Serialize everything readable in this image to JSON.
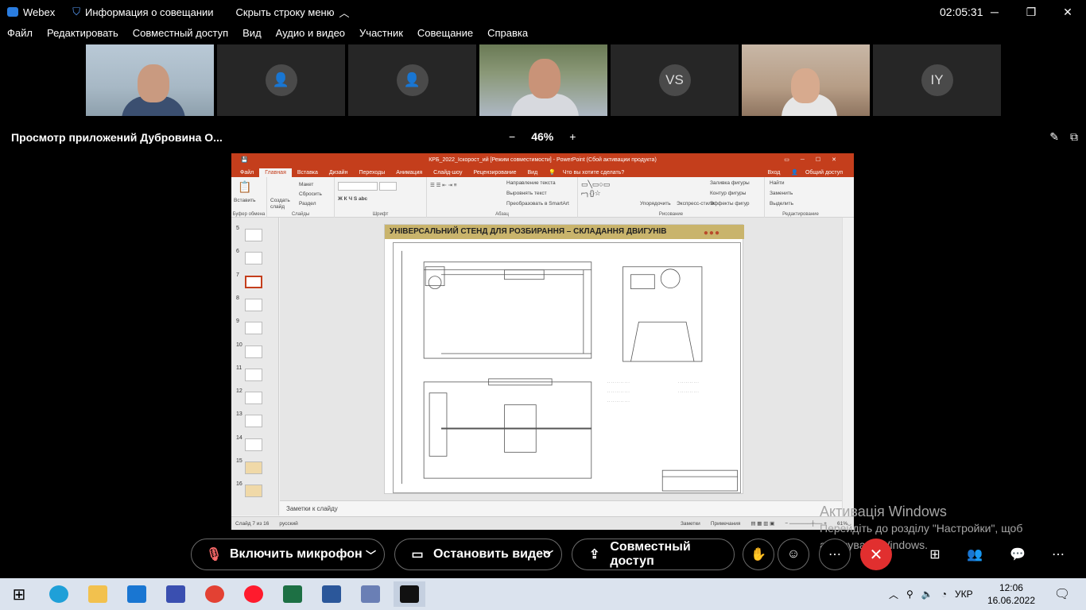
{
  "app": {
    "name": "Webex",
    "meeting_info": "Информация о совещании",
    "hide_menu": "Скрыть строку меню",
    "clock": "02:05:31"
  },
  "menu": [
    "Файл",
    "Редактировать",
    "Совместный доступ",
    "Вид",
    "Аудио и видео",
    "Участник",
    "Совещание",
    "Справка"
  ],
  "participants": [
    {
      "type": "video",
      "initials": ""
    },
    {
      "type": "avatar",
      "initials": ""
    },
    {
      "type": "avatar",
      "initials": ""
    },
    {
      "type": "video",
      "initials": ""
    },
    {
      "type": "avatar",
      "initials": "VS"
    },
    {
      "type": "video",
      "initials": ""
    },
    {
      "type": "avatar",
      "initials": "IY"
    }
  ],
  "share": {
    "title": "Просмотр приложений Дубровина О...",
    "zoom_minus": "−",
    "zoom": "46%",
    "zoom_plus": "+"
  },
  "ppt": {
    "title": "КРБ_2022_Іскорост_ий [Режим совместимости] - PowerPoint (Сбой активации продукта)",
    "tabs": [
      "Файл",
      "Главная",
      "Вставка",
      "Дизайн",
      "Переходы",
      "Анимация",
      "Слайд-шоу",
      "Рецензирование",
      "Вид"
    ],
    "tell_me": "Что вы хотите сделать?",
    "sign_in": "Вход",
    "share_btn": "Общий доступ",
    "groups": [
      "Буфер обмена",
      "Слайды",
      "Шрифт",
      "Абзац",
      "Рисование",
      "Редактирование"
    ],
    "ribbon": {
      "paste": "Вставить",
      "create_slide": "Создать слайд",
      "layout": "Макет",
      "reset": "Сбросить",
      "section": "Раздел",
      "text_dir": "Направление текста",
      "align_text": "Выровнять текст",
      "smartart": "Преобразовать в SmartArt",
      "arrange": "Упорядочить",
      "quick_styles": "Экспресс-стили",
      "fill": "Заливка фигуры",
      "outline": "Контур фигуры",
      "effects": "Эффекты фигур",
      "find": "Найти",
      "replace": "Заменить",
      "select": "Выделить"
    },
    "thumb_numbers": [
      "5",
      "6",
      "7",
      "8",
      "9",
      "10",
      "11",
      "12",
      "13",
      "14",
      "15",
      "16"
    ],
    "selected_thumb": "7",
    "slide_title": "УНІВЕРСАЛЬНИЙ СТЕНД ДЛЯ РОЗБИРАННЯ – СКЛАДАННЯ ДВИГУНІВ",
    "notes": "Заметки к слайду",
    "status": {
      "slide": "Слайд 7 из 16",
      "lang": "русский",
      "notes": "Заметки",
      "comments": "Примечания",
      "zoom": "61%"
    }
  },
  "watermark": {
    "title": "Активація Windows",
    "line1": "Перейдіть до розділу \"Настройки\", щоб",
    "line2": "активувати Windows."
  },
  "controls": {
    "mic": "Включить микрофон",
    "video": "Остановить видео",
    "share": "Совместный доступ"
  },
  "taskbar": {
    "lang": "УКР",
    "time": "12:06",
    "date": "16.06.2022"
  },
  "colors": {
    "ppt_accent": "#c43e1c",
    "end_call": "#e12f2f",
    "webex_blue": "#2a7de1"
  }
}
